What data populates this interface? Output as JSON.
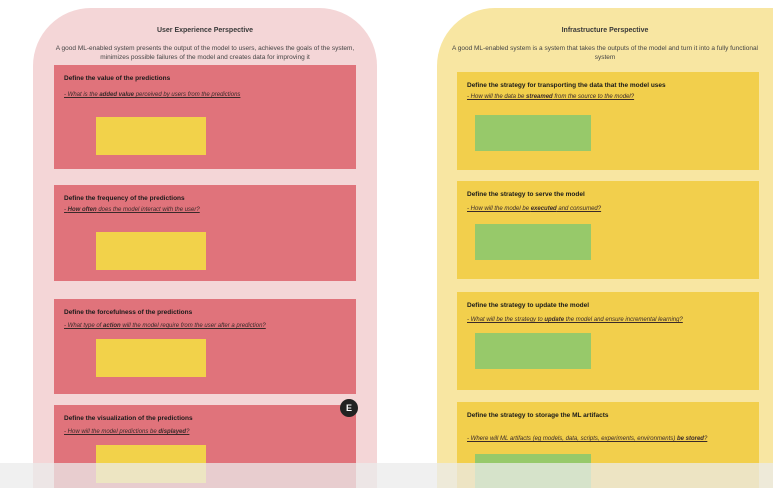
{
  "left": {
    "title": "User Experience Perspective",
    "description": "A good ML-enabled system presents the output of the model to users, achieves the goals of the system, minimizes possible failures of the model and creates data for improving it",
    "cards": [
      {
        "title": "Define the value of the predictions",
        "q_pre": "- What is the ",
        "q_bold": "added value",
        "q_post": " perceived by users from the predictions"
      },
      {
        "title": "Define the frequency of the predictions",
        "q_pre": "- ",
        "q_bold": "How often",
        "q_post": " does the model interact with the user?"
      },
      {
        "title": "Define the forcefulness of the predictions",
        "q_pre": "- What type of ",
        "q_bold": "action",
        "q_post": " will the model require from the user after a prediction?"
      },
      {
        "title": "Define the visualization of the predictions",
        "q_pre": "- How will the model predictions be ",
        "q_bold": "displayed",
        "q_post": "?"
      }
    ]
  },
  "right": {
    "title": "Infrastructure Perspective",
    "description": "A good ML-enabled system is a system that takes the outputs of the model and turn it into a fully functional system",
    "cards": [
      {
        "title": "Define the strategy for transporting the data that the model uses",
        "q_pre": "- How will the data be ",
        "q_bold": "streamed",
        "q_post": " from the source to the model?"
      },
      {
        "title": "Define the strategy to serve the model",
        "q_pre": "- How will the model be ",
        "q_bold": "executed",
        "q_post": " and consumed?"
      },
      {
        "title": "Define the strategy to update the model",
        "q_pre": "- What will be the strategy to ",
        "q_bold": "update",
        "q_post": " the model and ensure incremental learning?"
      },
      {
        "title": "Define the strategy to storage the ML artifacts",
        "q_pre": "- Where will ML artifacts (eg models, data, scripts, experiments, environments) ",
        "q_bold": "be stored",
        "q_post": "?"
      }
    ]
  },
  "badge": "E",
  "colors": {
    "left_bg": "#f4d6d7",
    "left_card": "#e0737b",
    "sticky_yellow": "#f2d24a",
    "right_bg": "#f8e6a2",
    "right_card": "#f2cf4c",
    "sticky_green": "#97c96a"
  }
}
